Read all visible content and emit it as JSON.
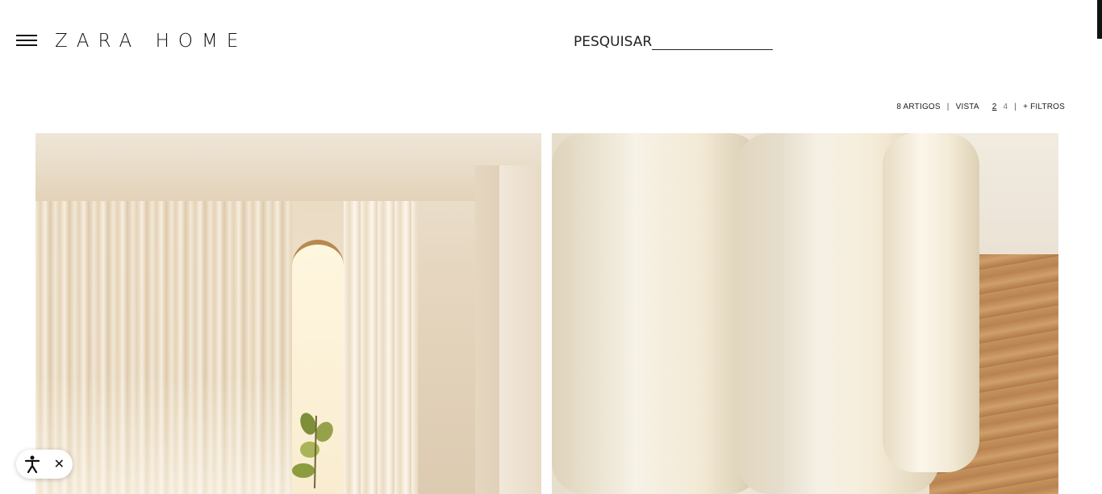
{
  "header": {
    "logo": "ZARA HOME",
    "search_label": "PESQUISAR"
  },
  "toolbar": {
    "article_count": "8 ARTIGOS",
    "separator": "|",
    "view_label": "VISTA",
    "view_options": [
      "2",
      "4"
    ],
    "filters_label": "+ FILTROS"
  },
  "icons": {
    "menu": "hamburger-menu-icon",
    "accessibility": "accessibility-person-icon",
    "close": "close-icon"
  },
  "accessibility_widget": {
    "close_glyph": "✕"
  },
  "colors": {
    "text": "#222222",
    "background": "#ffffff"
  }
}
